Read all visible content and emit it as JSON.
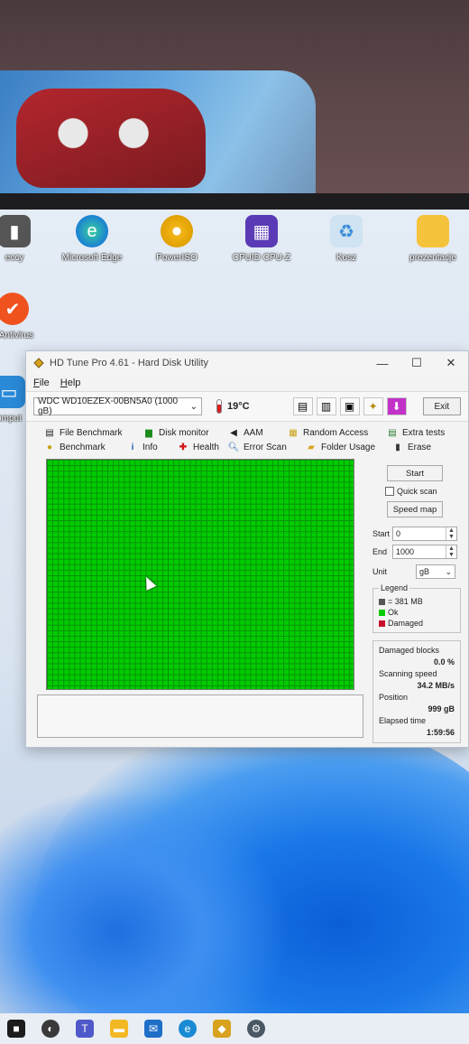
{
  "desktop": {
    "icons": [
      {
        "label": "eccy",
        "icon": "app-icon"
      },
      {
        "label": "Microsoft Edge",
        "icon": "edge-icon"
      },
      {
        "label": "PowerISO",
        "icon": "poweriso-icon"
      },
      {
        "label": "CPUID CPU-Z",
        "icon": "cpuz-icon"
      },
      {
        "label": "Kosz",
        "icon": "recycle-bin-icon"
      },
      {
        "label": "prezentacje",
        "icon": "folder-icon"
      },
      {
        "label": "e Antivirus",
        "icon": "antivirus-icon"
      },
      {
        "label": "omput",
        "icon": "computer-icon"
      }
    ]
  },
  "window": {
    "title": "HD Tune Pro 4.61 - Hard Disk Utility",
    "controls": {
      "minimize": "—",
      "maximize": "☐",
      "close": "✕"
    },
    "menu": [
      "File",
      "Help"
    ],
    "toolbar": {
      "drive": "WDC WD10EZEX-00BN5A0 (1000 gB)",
      "temperature": "19°C",
      "exit_label": "Exit"
    },
    "tabs_row1": [
      {
        "label": "File Benchmark",
        "icon": "file-benchmark-icon"
      },
      {
        "label": "Disk monitor",
        "icon": "disk-monitor-icon"
      },
      {
        "label": "AAM",
        "icon": "speaker-icon"
      },
      {
        "label": "Random Access",
        "icon": "random-access-icon"
      },
      {
        "label": "Extra tests",
        "icon": "extra-tests-icon"
      }
    ],
    "tabs_row2": [
      {
        "label": "Benchmark",
        "icon": "benchmark-icon"
      },
      {
        "label": "Info",
        "icon": "info-icon"
      },
      {
        "label": "Health",
        "icon": "health-icon"
      },
      {
        "label": "Error Scan",
        "icon": "error-scan-icon"
      },
      {
        "label": "Folder Usage",
        "icon": "folder-usage-icon"
      },
      {
        "label": "Erase",
        "icon": "erase-icon"
      }
    ],
    "side": {
      "start_button": "Start",
      "quick_scan": "Quick scan",
      "speed_map": "Speed map",
      "start_label": "Start",
      "start_value": "0",
      "end_label": "End",
      "end_value": "1000",
      "unit_label": "Unit",
      "unit_value": "gB",
      "legend_title": "Legend",
      "legend_block": "= 381 MB",
      "legend_ok": "Ok",
      "legend_damaged": "Damaged",
      "damaged_blocks_label": "Damaged blocks",
      "damaged_blocks_value": "0.0 %",
      "scanning_speed_label": "Scanning speed",
      "scanning_speed_value": "34.2 MB/s",
      "position_label": "Position",
      "position_value": "999 gB",
      "elapsed_label": "Elapsed time",
      "elapsed_value": "1:59:56"
    },
    "colors": {
      "ok": "#00cc00",
      "damaged": "#c8102e",
      "block": "#555555"
    }
  },
  "taskbar": {
    "icons": [
      "start-icon",
      "search-icon",
      "teams-icon",
      "file-explorer-icon",
      "mail-icon",
      "edge-icon",
      "hdtune-icon",
      "settings-icon"
    ]
  }
}
